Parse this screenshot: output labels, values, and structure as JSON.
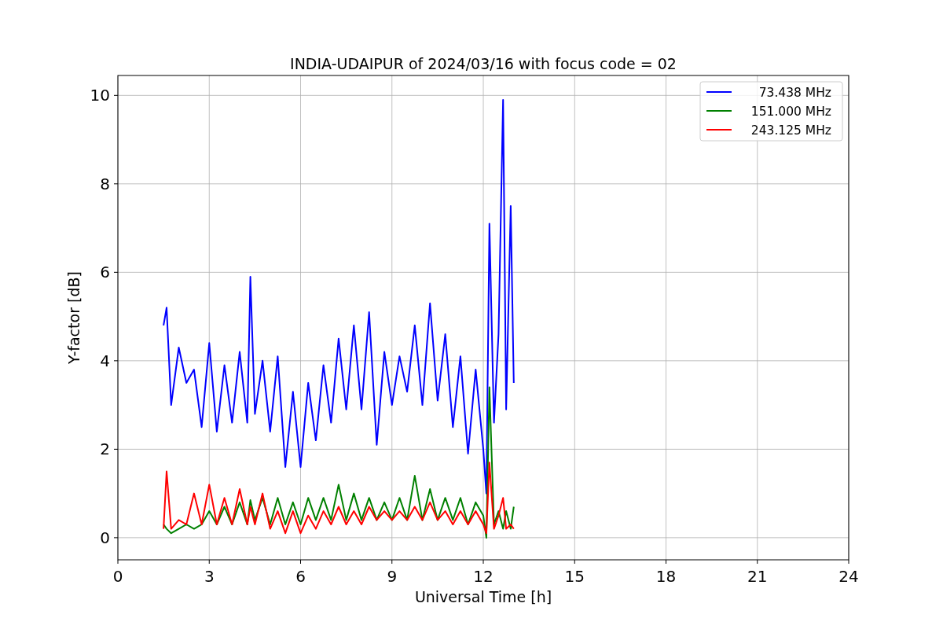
{
  "figure": {
    "chart_data": {
      "type": "line",
      "title": "INDIA-UDAIPUR of 2024/03/16 with focus code = 02",
      "xlabel": "Universal Time [h]",
      "ylabel": "Y-factor [dB]",
      "x": [
        1.5,
        1.6,
        1.75,
        2,
        2.25,
        2.5,
        2.75,
        3,
        3.25,
        3.5,
        3.75,
        4,
        4.25,
        4.35,
        4.5,
        4.75,
        5,
        5.25,
        5.5,
        5.75,
        6,
        6.25,
        6.5,
        6.75,
        7,
        7.25,
        7.5,
        7.75,
        8,
        8.25,
        8.5,
        8.75,
        9,
        9.25,
        9.5,
        9.75,
        10,
        10.25,
        10.5,
        10.75,
        11,
        11.25,
        11.5,
        11.75,
        12,
        12.1,
        12.2,
        12.35,
        12.5,
        12.65,
        12.75,
        12.9,
        13
      ],
      "series": [
        {
          "name": "  73.438 MHz",
          "color": "#0000ff",
          "values": [
            4.8,
            5.2,
            3.0,
            4.3,
            3.5,
            3.8,
            2.5,
            4.4,
            2.4,
            3.9,
            2.6,
            4.2,
            2.6,
            5.9,
            2.8,
            4.0,
            2.4,
            4.1,
            1.6,
            3.3,
            1.6,
            3.5,
            2.2,
            3.9,
            2.6,
            4.5,
            2.9,
            4.8,
            2.9,
            5.1,
            2.1,
            4.2,
            3.0,
            4.1,
            3.3,
            4.8,
            3.0,
            5.3,
            3.1,
            4.6,
            2.5,
            4.1,
            1.9,
            3.8,
            2.0,
            1.0,
            7.1,
            2.6,
            4.6,
            9.9,
            2.9,
            7.5,
            3.5
          ]
        },
        {
          "name": "151.000 MHz",
          "color": "#008000",
          "values": [
            0.3,
            0.2,
            0.1,
            0.2,
            0.3,
            0.2,
            0.3,
            0.6,
            0.3,
            0.7,
            0.3,
            0.8,
            0.3,
            0.85,
            0.4,
            0.9,
            0.3,
            0.9,
            0.3,
            0.8,
            0.3,
            0.9,
            0.4,
            0.9,
            0.4,
            1.2,
            0.4,
            1.0,
            0.4,
            0.9,
            0.4,
            0.8,
            0.4,
            0.9,
            0.4,
            1.4,
            0.4,
            1.1,
            0.4,
            0.9,
            0.4,
            0.9,
            0.3,
            0.8,
            0.5,
            0.0,
            3.4,
            0.3,
            0.6,
            0.2,
            0.6,
            0.2,
            0.7
          ]
        },
        {
          "name": "243.125 MHz",
          "color": "#ff0000",
          "values": [
            0.2,
            1.5,
            0.2,
            0.4,
            0.3,
            1.0,
            0.3,
            1.2,
            0.3,
            0.9,
            0.3,
            1.1,
            0.3,
            0.7,
            0.3,
            1.0,
            0.2,
            0.6,
            0.1,
            0.6,
            0.1,
            0.5,
            0.2,
            0.6,
            0.3,
            0.7,
            0.3,
            0.6,
            0.3,
            0.7,
            0.4,
            0.6,
            0.4,
            0.6,
            0.4,
            0.7,
            0.4,
            0.8,
            0.4,
            0.6,
            0.3,
            0.6,
            0.3,
            0.6,
            0.3,
            0.1,
            1.7,
            0.2,
            0.5,
            0.9,
            0.2,
            0.3,
            0.2
          ]
        }
      ],
      "grid": true,
      "legend": "upper right",
      "xlim": [
        0,
        24
      ],
      "ylim": [
        -0.5,
        10.45
      ],
      "xticks": [
        0,
        3,
        6,
        9,
        12,
        15,
        18,
        21,
        24
      ],
      "yticks": [
        0,
        2,
        4,
        6,
        8,
        10
      ]
    }
  }
}
